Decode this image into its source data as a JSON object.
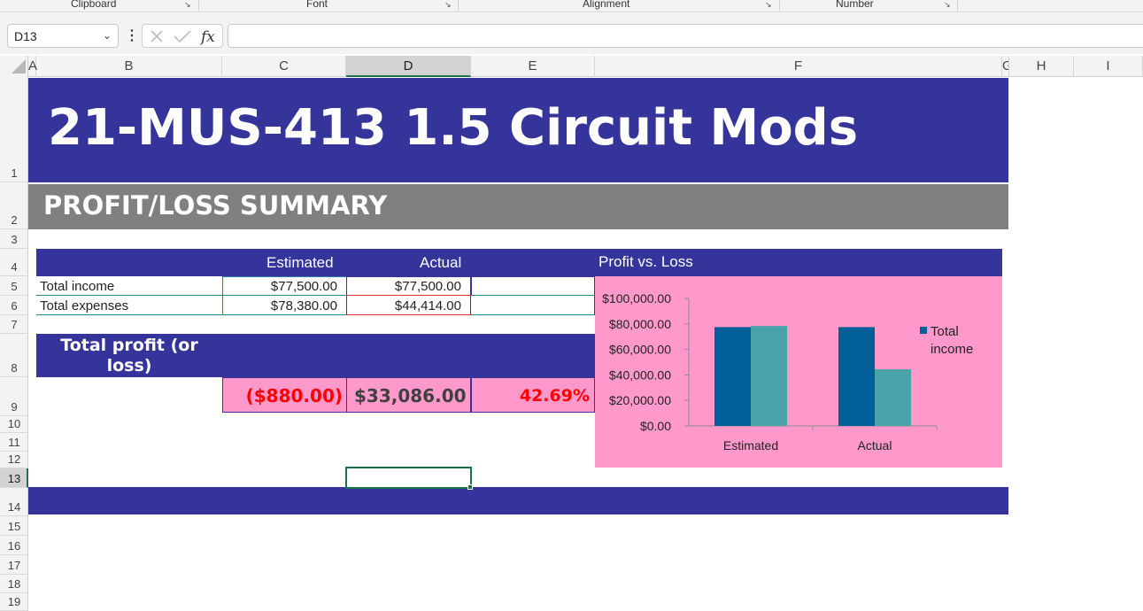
{
  "ribbon": {
    "groups": [
      "Clipboard",
      "Font",
      "Alignment",
      "Number"
    ]
  },
  "formula_bar": {
    "name_box": "D13",
    "formula": ""
  },
  "columns": [
    "A",
    "B",
    "C",
    "D",
    "E",
    "F",
    "G",
    "H",
    "I"
  ],
  "rows": [
    "1",
    "2",
    "3",
    "4",
    "5",
    "6",
    "7",
    "8",
    "9",
    "10",
    "11",
    "12",
    "13",
    "14",
    "15",
    "16",
    "17",
    "18",
    "19"
  ],
  "selected": {
    "cell": "D13",
    "column": "D",
    "row": "13"
  },
  "sheet": {
    "title": "21-MUS-413 1.5 Circuit Mods",
    "subtitle": "PROFIT/LOSS SUMMARY",
    "table": {
      "headers": [
        "Estimated",
        "Actual"
      ],
      "rows": [
        {
          "label": "Total income",
          "estimated": "$77,500.00",
          "actual": "$77,500.00"
        },
        {
          "label": "Total expenses",
          "estimated": "$78,380.00",
          "actual": "$44,414.00"
        }
      ]
    },
    "total_profit": {
      "label": "Total profit (or loss)",
      "estimated": "($880.00)",
      "actual": "$33,086.00",
      "percent": "42.69%"
    }
  },
  "colors": {
    "band": "#35349a",
    "subtitle_band": "#808080",
    "chart_background": "#ff99cc",
    "negative": "#ff0000",
    "series_income": "#005f99",
    "series_expenses": "#4aa3a8"
  },
  "chart_data": {
    "type": "bar",
    "title": "Profit vs. Loss",
    "categories": [
      "Estimated",
      "Actual"
    ],
    "series": [
      {
        "name": "Total income",
        "values": [
          77500,
          77500
        ]
      },
      {
        "values": [
          78380,
          44414
        ]
      }
    ],
    "ylim": [
      0,
      100000
    ],
    "yticks": [
      "$0.00",
      "$20,000.00",
      "$40,000.00",
      "$60,000.00",
      "$80,000.00",
      "$100,000.00"
    ],
    "legend_position": "right",
    "grid": false
  }
}
